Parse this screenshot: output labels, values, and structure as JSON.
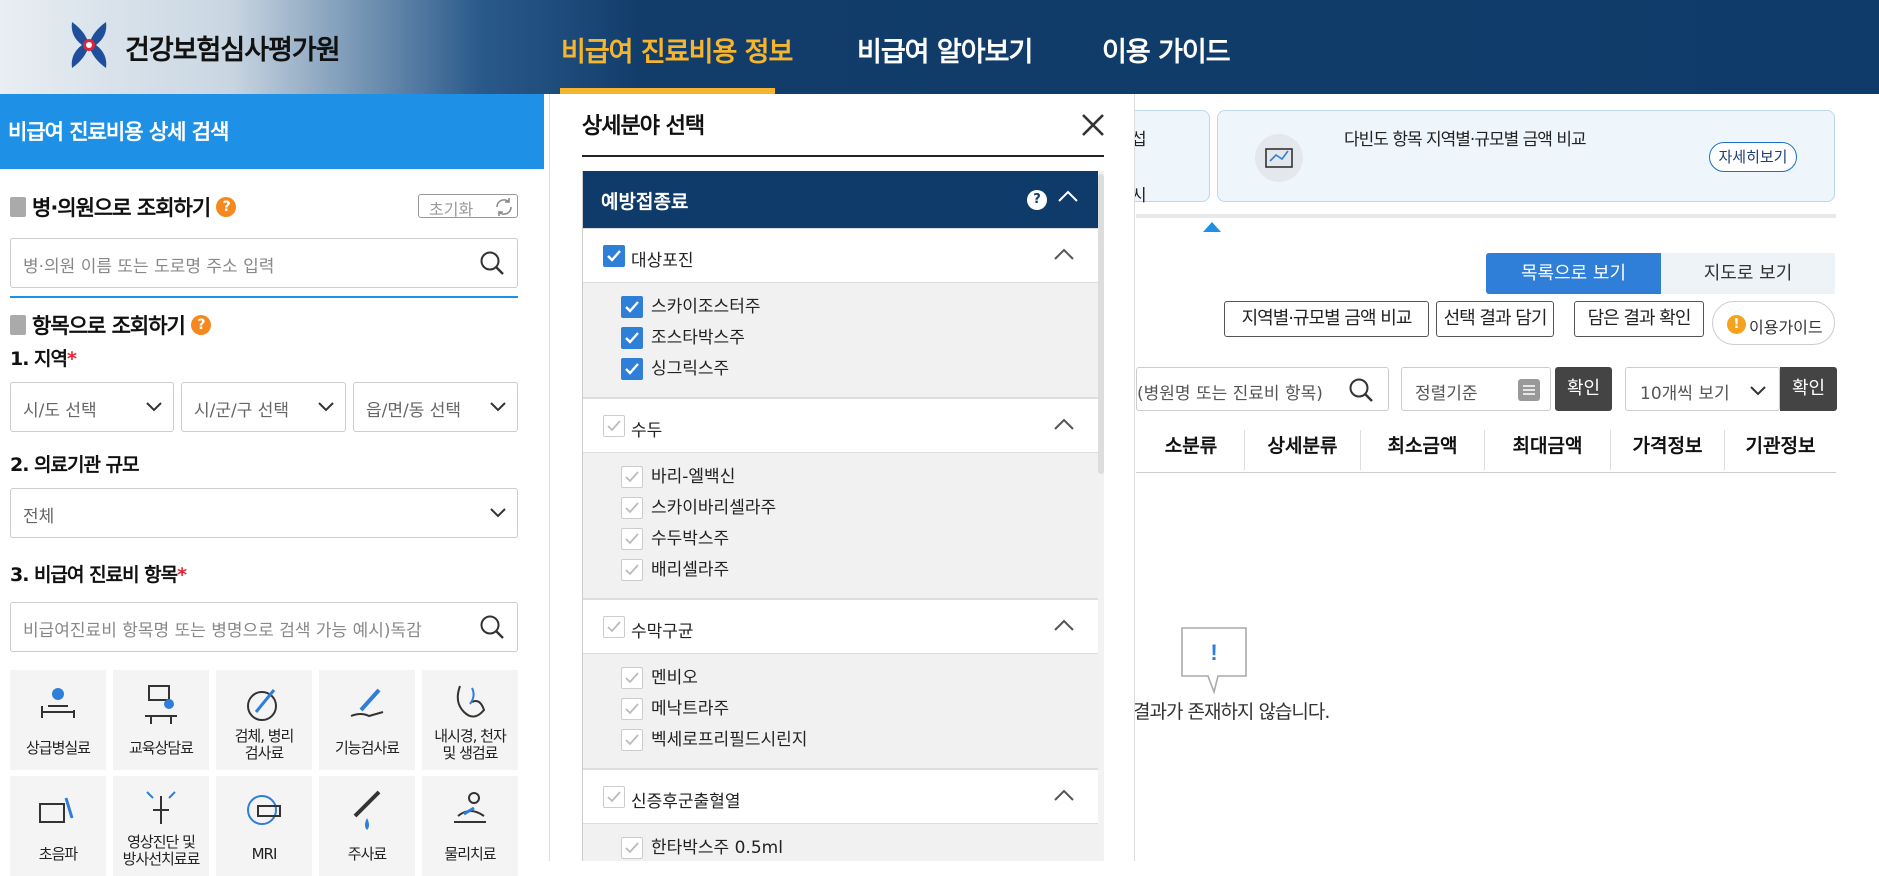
{
  "header": {
    "brand": "건강보험심사평가원",
    "nav": [
      "비급여 진료비용 정보",
      "비급여 알아보기",
      "이용 가이드"
    ],
    "active_color": "#f5b52e",
    "bg_color": "#0e3b69"
  },
  "left_panel": {
    "title": "비급여 진료비용 상세 검색",
    "hospital_section": {
      "label": "병·의원으로 조회하기",
      "help": "?",
      "reset": "초기화",
      "placeholder": "병·의원 이름 또는 도로명 주소 입력"
    },
    "item_section": {
      "label": "항목으로 조회하기",
      "help": "?"
    },
    "region": {
      "label": "1. 지역",
      "required": "*",
      "selects": [
        "시/도 선택",
        "시/군/구 선택",
        "읍/면/동 선택"
      ]
    },
    "scale": {
      "label": "2. 의료기관 규모",
      "value": "전체"
    },
    "items": {
      "label": "3. 비급여 진료비 항목",
      "required": "*",
      "placeholder": "비급여진료비 항목명 또는 병명으로 검색 가능 예시)독감"
    },
    "categories": [
      {
        "label": "상급병실료",
        "icon": "bed-icon"
      },
      {
        "label": "교육상담료",
        "icon": "consult-icon"
      },
      {
        "label": "검체, 병리\n검사료",
        "icon": "specimen-icon"
      },
      {
        "label": "기능검사료",
        "icon": "function-test-icon"
      },
      {
        "label": "내시경, 천자\n및 생검료",
        "icon": "endoscope-icon"
      },
      {
        "label": "초음파",
        "icon": "ultrasound-icon"
      },
      {
        "label": "영상진단 및\n방사선치료료",
        "icon": "imaging-icon"
      },
      {
        "label": "MRI",
        "icon": "mri-icon"
      },
      {
        "label": "주사료",
        "icon": "syringe-icon"
      },
      {
        "label": "물리치료",
        "icon": "physio-icon"
      }
    ]
  },
  "modal": {
    "title": "상세분야 선택",
    "close": "close",
    "category": "예방접종료",
    "groups": [
      {
        "name": "대상포진",
        "checked": true,
        "items": [
          {
            "label": "스카이조스터주",
            "checked": true
          },
          {
            "label": "조스타박스주",
            "checked": true
          },
          {
            "label": "싱그릭스주",
            "checked": true
          }
        ]
      },
      {
        "name": "수두",
        "checked": false,
        "items": [
          {
            "label": "바리-엘백신",
            "checked": false
          },
          {
            "label": "스카이바리셀라주",
            "checked": false
          },
          {
            "label": "수두박스주",
            "checked": false
          },
          {
            "label": "배리셀라주",
            "checked": false
          }
        ]
      },
      {
        "name": "수막구균",
        "checked": false,
        "items": [
          {
            "label": "멘비오",
            "checked": false
          },
          {
            "label": "메낙트라주",
            "checked": false
          },
          {
            "label": "벡세로프리필드시린지",
            "checked": false
          }
        ]
      },
      {
        "name": "신증후군출혈열",
        "checked": false,
        "items": [
          {
            "label": "한타박스주 0.5ml",
            "checked": false
          }
        ]
      }
    ]
  },
  "right": {
    "card1_partial": [
      "섭",
      "시"
    ],
    "card2_text": "다빈도 항목 지역별·규모별 금액 비교",
    "card2_btn": "자세히보기",
    "view_list": "목록으로 보기",
    "view_map": "지도로 보기",
    "buttons": [
      "지역별·규모별 금액 비교",
      "선택 결과 담기",
      "담은 결과 확인"
    ],
    "guide": "이용가이드",
    "search_placeholder": "(병원명 또는 진료비 항목)",
    "sort_placeholder": "정렬기준",
    "confirm1": "확인",
    "page_size": "10개씩 보기",
    "confirm2": "확인",
    "table_headers": [
      "소분류",
      "상세분류",
      "최소금액",
      "최대금액",
      "가격정보",
      "기관정보"
    ],
    "empty_message": "결과가 존재하지 않습니다."
  }
}
